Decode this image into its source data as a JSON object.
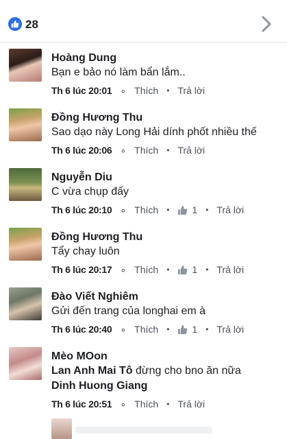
{
  "header": {
    "like_count": "28",
    "like_icon": "thumbs-up-icon",
    "nav_icon": "chevron-right-icon"
  },
  "comments": [
    {
      "author": "Hoàng Dung",
      "text": "Bạn e bảo nó làm bẩn lắm..",
      "time": "Th 6 lúc 20:01",
      "like_label": "Thích",
      "reply_label": "Trả lời",
      "reactions": ""
    },
    {
      "author": "Đồng Hương Thu",
      "text": "Sao dạo này Long Hải dính phốt nhiều thế",
      "time": "Th 6 lúc 20:06",
      "like_label": "Thích",
      "reply_label": "Trả lời",
      "reactions": ""
    },
    {
      "author": "Nguyễn Diu",
      "text": "C vừa chụp đấy",
      "time": "Th 6 lúc 20:10",
      "like_label": "Thích",
      "reply_label": "Trả lời",
      "reactions": "1"
    },
    {
      "author": "Đồng Hương Thu",
      "text": "Tẩy chay luôn",
      "time": "Th 6 lúc 20:17",
      "like_label": "Thích",
      "reply_label": "Trả lời",
      "reactions": "1"
    },
    {
      "author": "Đào Viết Nghiêm",
      "text": "Gửi đến trang của longhai em à",
      "time": "Th 6 lúc 20:40",
      "like_label": "Thích",
      "reply_label": "Trả lời",
      "reactions": "1"
    },
    {
      "author": "Mèo MOon",
      "mention1": "Lan Anh Mai Tô",
      "text_mid": " đừng cho bno ăn nữa",
      "mention2": "Dinh Huong Giang",
      "time": "Th 6 lúc 20:51",
      "like_label": "Thích",
      "reply_label": "Trả lời",
      "reactions": ""
    }
  ],
  "colors": {
    "accent": "#2f6fe0",
    "text": "#1c1e21",
    "meta": "#4b4f56",
    "reaction_icon": "#8d949e"
  }
}
